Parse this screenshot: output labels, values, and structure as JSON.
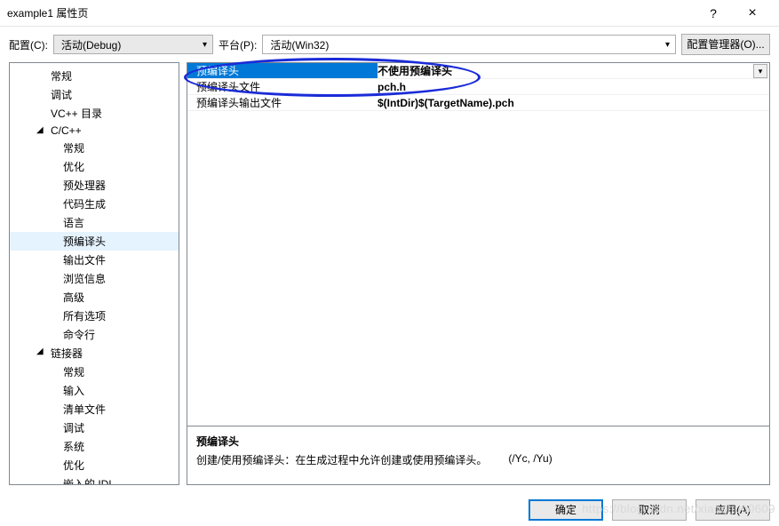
{
  "window": {
    "title": "example1 属性页",
    "help": "?",
    "close": "×"
  },
  "toprow": {
    "config_label": "配置(C):",
    "config_value": "活动(Debug)",
    "platform_label": "平台(P):",
    "platform_value": "活动(Win32)",
    "manager_button": "配置管理器(O)..."
  },
  "tree": [
    {
      "label": "常规",
      "level": 2
    },
    {
      "label": "调试",
      "level": 2
    },
    {
      "label": "VC++ 目录",
      "level": 2
    },
    {
      "label": "C/C++",
      "level": 2,
      "expanded": true
    },
    {
      "label": "常规",
      "level": 3
    },
    {
      "label": "优化",
      "level": 3
    },
    {
      "label": "预处理器",
      "level": 3
    },
    {
      "label": "代码生成",
      "level": 3
    },
    {
      "label": "语言",
      "level": 3
    },
    {
      "label": "预编译头",
      "level": 3,
      "selected": true
    },
    {
      "label": "输出文件",
      "level": 3
    },
    {
      "label": "浏览信息",
      "level": 3
    },
    {
      "label": "高级",
      "level": 3
    },
    {
      "label": "所有选项",
      "level": 3
    },
    {
      "label": "命令行",
      "level": 3
    },
    {
      "label": "链接器",
      "level": 2,
      "expanded": true
    },
    {
      "label": "常规",
      "level": 3
    },
    {
      "label": "输入",
      "level": 3
    },
    {
      "label": "清单文件",
      "level": 3
    },
    {
      "label": "调试",
      "level": 3
    },
    {
      "label": "系统",
      "level": 3
    },
    {
      "label": "优化",
      "level": 3
    },
    {
      "label": "嵌入的 IDL",
      "level": 3
    }
  ],
  "grid": [
    {
      "name": "预编译头",
      "value": "不使用预编译头",
      "selected": true,
      "dropdown": true
    },
    {
      "name": "预编译头文件",
      "value": "pch.h"
    },
    {
      "name": "预编译头输出文件",
      "value": "$(IntDir)$(TargetName).pch"
    }
  ],
  "description": {
    "title": "预编译头",
    "body": "创建/使用预编译头：在生成过程中允许创建或使用预编译头。",
    "flags": "(/Yc, /Yu)"
  },
  "footer": {
    "ok": "确定",
    "cancel": "取消",
    "apply": "应用(A)"
  },
  "watermark": "https://blog.csdn.net/xiaoshuo0609"
}
